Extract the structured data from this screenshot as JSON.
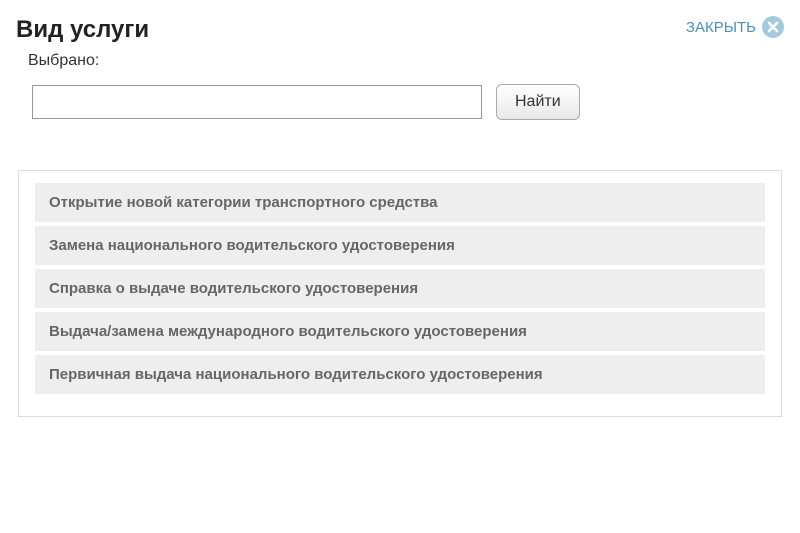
{
  "header": {
    "title": "Вид услуги",
    "close_label": "ЗАКРЫТЬ"
  },
  "search": {
    "selected_label": "Выбрано:",
    "input_value": "",
    "button_label": "Найти"
  },
  "services": [
    {
      "label": "Открытие новой категории транспортного средства"
    },
    {
      "label": "Замена национального водительского удостоверения"
    },
    {
      "label": "Справка о выдаче водительского удостоверения"
    },
    {
      "label": "Выдача/замена международного водительского удостоверения"
    },
    {
      "label": "Первичная выдача национального водительского удостоверения"
    }
  ]
}
